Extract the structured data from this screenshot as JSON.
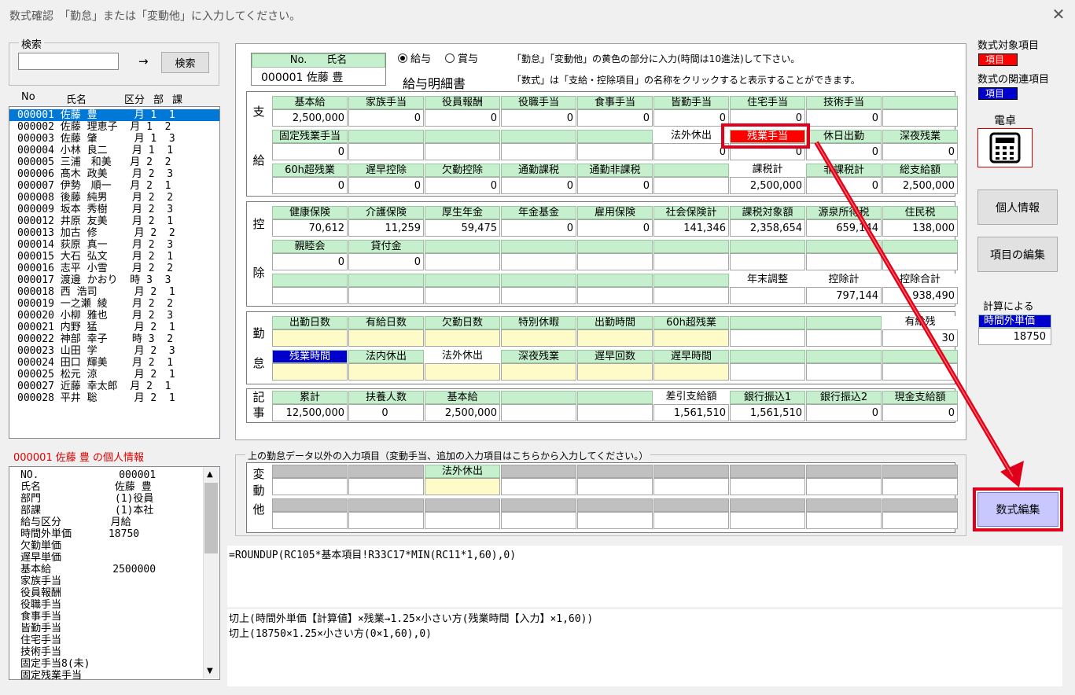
{
  "window": {
    "title": "数式確認　「勤怠」または「変動他」に入力してください。",
    "close": "✕"
  },
  "search": {
    "group_label": "検索",
    "value": "",
    "arrow": "→",
    "button": "検索"
  },
  "list_header": {
    "no": "No",
    "name": "氏名",
    "kubun": "区分",
    "bu": "部",
    "ka": "課"
  },
  "employees": [
    [
      "000001",
      "佐藤 豊",
      "月",
      "1",
      "1"
    ],
    [
      "000002",
      "佐藤 理恵子",
      "月",
      "1",
      "2"
    ],
    [
      "000003",
      "佐藤 肇",
      "月",
      "1",
      "3"
    ],
    [
      "000004",
      "小林 良二",
      "月",
      "1",
      "1"
    ],
    [
      "000005",
      "三浦　和美",
      "月",
      "2",
      "2"
    ],
    [
      "000006",
      "髙木 政美",
      "月",
      "2",
      "3"
    ],
    [
      "000007",
      "伊勢　順一",
      "月",
      "2",
      "1"
    ],
    [
      "000008",
      "後藤 純男",
      "月",
      "2",
      "2"
    ],
    [
      "000009",
      "坂本 秀樹",
      "月",
      "2",
      "3"
    ],
    [
      "000012",
      "井原 友美",
      "月",
      "2",
      "1"
    ],
    [
      "000013",
      "加古 修",
      "月",
      "2",
      "2"
    ],
    [
      "000014",
      "荻原 真一",
      "月",
      "2",
      "3"
    ],
    [
      "000015",
      "大石 弘文",
      "月",
      "2",
      "1"
    ],
    [
      "000016",
      "志平 小雪",
      "月",
      "2",
      "2"
    ],
    [
      "000017",
      "渡邊 かおり",
      "時",
      "3",
      "3"
    ],
    [
      "000018",
      "西 浩司",
      "月",
      "2",
      "1"
    ],
    [
      "000019",
      "一之瀬 綾",
      "月",
      "2",
      "2"
    ],
    [
      "000020",
      "小柳 雅也",
      "月",
      "2",
      "3"
    ],
    [
      "000021",
      "内野 猛",
      "月",
      "2",
      "1"
    ],
    [
      "000022",
      "神部 幸子",
      "時",
      "3",
      "2"
    ],
    [
      "000023",
      "山田 学",
      "月",
      "2",
      "3"
    ],
    [
      "000024",
      "田口 輝美",
      "月",
      "2",
      "1"
    ],
    [
      "000025",
      "松元 涼",
      "月",
      "2",
      "1"
    ],
    [
      "000027",
      "近藤 幸太郎",
      "月",
      "2",
      "1"
    ],
    [
      "000028",
      "平井 聡",
      "月",
      "2",
      "1"
    ]
  ],
  "personal_title": "000001 佐藤 豊 の個人情報",
  "personal_info": [
    [
      "NO.",
      "000001"
    ],
    [
      "氏名",
      "佐藤 豊"
    ],
    [
      "部門",
      "(1)役員"
    ],
    [
      "部課",
      "(1)本社"
    ],
    [
      "給与区分",
      "月給"
    ],
    [
      "時間外単価",
      "18750"
    ],
    [
      "欠勤単価",
      ""
    ],
    [
      "遅早単価",
      ""
    ],
    [
      "基本給",
      "2500000"
    ],
    [
      "家族手当",
      ""
    ],
    [
      "役員報酬",
      ""
    ],
    [
      "役職手当",
      ""
    ],
    [
      "食事手当",
      ""
    ],
    [
      "皆勤手当",
      ""
    ],
    [
      "住宅手当",
      ""
    ],
    [
      "技術手当",
      ""
    ],
    [
      "固定手当8(未)",
      ""
    ],
    [
      "固定残業手当",
      ""
    ]
  ],
  "header": {
    "no_label": "No.",
    "name_label": "氏名",
    "emp_value": "000001 佐藤 豊",
    "radio1": "給与",
    "radio2": "賞与",
    "slip_title": "給与明細書",
    "note1": "「勤怠」「変動他」の黄色の部分に入力(時間は10進法)して下さい。",
    "note2": "「数式」は「支給・控除項目」の名称をクリックすると表示することができます。"
  },
  "sections": {
    "shikyu": {
      "side": [
        "支",
        "給"
      ],
      "rows": [
        {
          "h": [
            "基本給",
            "家族手当",
            "役員報酬",
            "役職手当",
            "食事手当",
            "皆勤手当",
            "住宅手当",
            "技術手当",
            ""
          ],
          "v": [
            "2,500,000",
            "0",
            "0",
            "0",
            "0",
            "0",
            "0",
            "0",
            ""
          ]
        },
        {
          "h": [
            "固定残業手当",
            "",
            "",
            "",
            "",
            "法外休出",
            "残業手当",
            "休日出勤",
            "深夜残業"
          ],
          "v": [
            "0",
            "",
            "",
            "",
            "",
            "0",
            "0",
            "0",
            "0"
          ]
        },
        {
          "h": [
            "60h超残業",
            "遅早控除",
            "欠勤控除",
            "通勤課税",
            "通勤非課税",
            "",
            "課税計",
            "非課税計",
            "総支給額"
          ],
          "v": [
            "0",
            "0",
            "0",
            "0",
            "0",
            "",
            "2,500,000",
            "0",
            "2,500,000"
          ]
        }
      ]
    },
    "kojo": {
      "side": [
        "控",
        "除"
      ],
      "rows": [
        {
          "h": [
            "健康保険",
            "介護保険",
            "厚生年金",
            "年金基金",
            "雇用保険",
            "社会保険計",
            "課税対象額",
            "源泉所得税",
            "住民税"
          ],
          "v": [
            "70,612",
            "11,259",
            "59,475",
            "0",
            "0",
            "141,346",
            "2,358,654",
            "659,144",
            "138,000"
          ]
        },
        {
          "h": [
            "親睦会",
            "貸付金",
            "",
            "",
            "",
            "",
            "",
            "",
            ""
          ],
          "v": [
            "0",
            "0",
            "",
            "",
            "",
            "",
            "",
            "",
            ""
          ]
        },
        {
          "h": [
            "",
            "",
            "",
            "",
            "",
            "",
            "年末調整",
            "控除計",
            "控除合計"
          ],
          "v": [
            "",
            "",
            "",
            "",
            "",
            "",
            "",
            "797,144",
            "938,490"
          ]
        }
      ]
    },
    "kintai": {
      "side": [
        "勤",
        "怠"
      ],
      "rows": [
        {
          "h": [
            "出勤日数",
            "有給日数",
            "欠勤日数",
            "特別休暇",
            "出勤時間",
            "60h超残業",
            "",
            "",
            "有給残"
          ],
          "v": [
            "",
            "",
            "",
            "",
            "",
            "",
            "",
            "",
            "30"
          ]
        },
        {
          "h": [
            "残業時間",
            "法内休出",
            "法外休出",
            "深夜残業",
            "遅早回数",
            "遅早時間",
            "",
            "",
            ""
          ],
          "v": [
            "",
            "",
            "",
            "",
            "",
            "",
            "",
            "",
            ""
          ]
        }
      ]
    },
    "kiji": {
      "side": [
        "記",
        "事"
      ],
      "rows": [
        {
          "h": [
            "累計",
            "扶養人数",
            "基本給",
            "",
            "",
            "差引支給額",
            "銀行振込1",
            "銀行振込2",
            "現金支給額"
          ],
          "v": [
            "12,500,000",
            "0",
            "2,500,000",
            "",
            "",
            "1,561,510",
            "1,561,510",
            "0",
            "0"
          ]
        }
      ]
    },
    "hendo": {
      "group_label": "上の勤怠データ以外の入力項目（変動手当、追加の入力項目はこちらから入力してください。）",
      "side": [
        "変",
        "動",
        "他"
      ],
      "rows": [
        {
          "h": [
            "",
            "",
            "法外休出",
            "",
            "",
            "",
            "",
            "",
            ""
          ],
          "v": [
            "",
            "",
            "",
            "",
            "",
            "",
            "",
            "",
            ""
          ]
        },
        {
          "h": [
            "",
            "",
            "",
            "",
            "",
            "",
            "",
            "",
            ""
          ],
          "v": [
            "",
            "",
            "",
            "",
            "",
            "",
            "",
            "",
            ""
          ]
        }
      ]
    }
  },
  "right": {
    "target_label": "数式対象項目",
    "target_tag": "項目",
    "related_label": "数式の関連項目",
    "related_tag": "項目",
    "calc_label": "電卓",
    "personal_btn": "個人情報",
    "edit_items_btn": "項目の編集",
    "calc_by_label": "計算による",
    "calc_by_item": "時間外単価",
    "calc_by_value": "18750",
    "formula_edit_btn": "数式編集"
  },
  "formula": {
    "expr": "=ROUNDUP(RC105*基本項目!R33C17*MIN(RC11*1,60),0)",
    "explain1": "切上(時間外単価【計算値】×残業→1.25×小さい方(残業時間【入力】×1,60))",
    "explain2": "切上(18750×1.25×小さい方(0×1,60),0)"
  },
  "colors": {
    "highlight_red": "#e0001b",
    "selected_blue": "#0078d7",
    "green_header": "#c6efce",
    "yellow_input": "#fffbc9",
    "formula_btn": "#c8c8ff"
  }
}
